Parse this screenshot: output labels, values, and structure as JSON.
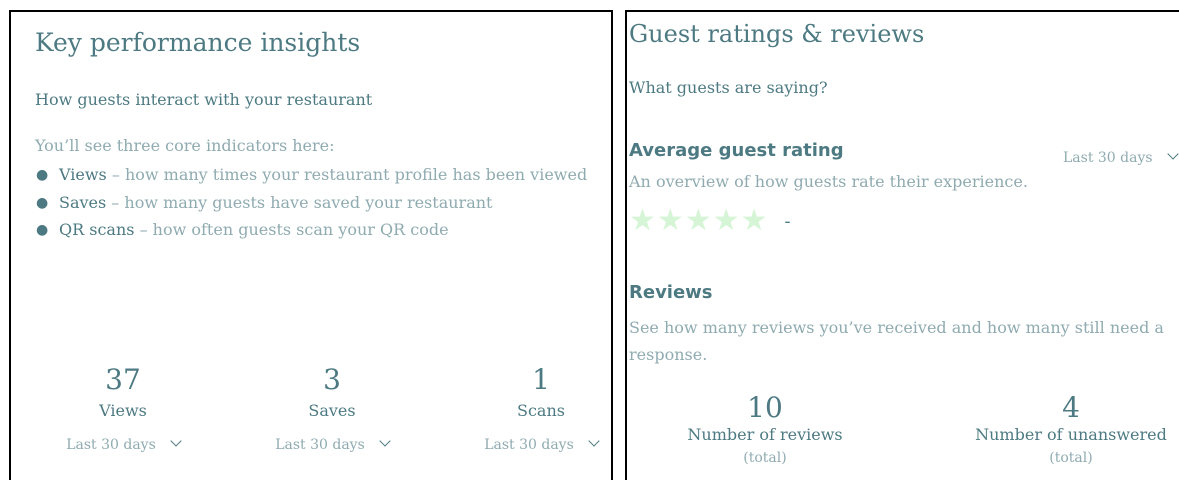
{
  "kpi": {
    "title": "Key performance insights",
    "subtitle": "How guests interact with your restaurant",
    "intro": "You’ll see three core indicators here:",
    "items": [
      {
        "term": "Views",
        "desc": " – how many times your restaurant profile has been viewed"
      },
      {
        "term": "Saves",
        "desc": " – how many guests have saved your restaurant"
      },
      {
        "term": "QR scans",
        "desc": " – how often guests scan your QR code"
      }
    ],
    "metrics": [
      {
        "value": "37",
        "label": "Views",
        "range": "Last 30 days"
      },
      {
        "value": "3",
        "label": "Saves",
        "range": "Last 30 days"
      },
      {
        "value": "1",
        "label": "Scans",
        "range": "Last 30 days"
      }
    ]
  },
  "guest": {
    "title": "Guest ratings & reviews",
    "subtitle": "What guests are saying?",
    "average": {
      "heading": "Average guest rating",
      "range": "Last 30 days",
      "description": "An overview of how guests rate their experience.",
      "stars": 5,
      "star_color": "#d6f5d6",
      "value": "-"
    },
    "reviews": {
      "heading": "Reviews",
      "description": "See how many reviews you’ve received and how many still need a response.",
      "metrics": [
        {
          "value": "10",
          "label": "Number of reviews",
          "note": "(total)"
        },
        {
          "value": "4",
          "label": "Number of unanswered",
          "note": "(total)"
        }
      ]
    }
  }
}
